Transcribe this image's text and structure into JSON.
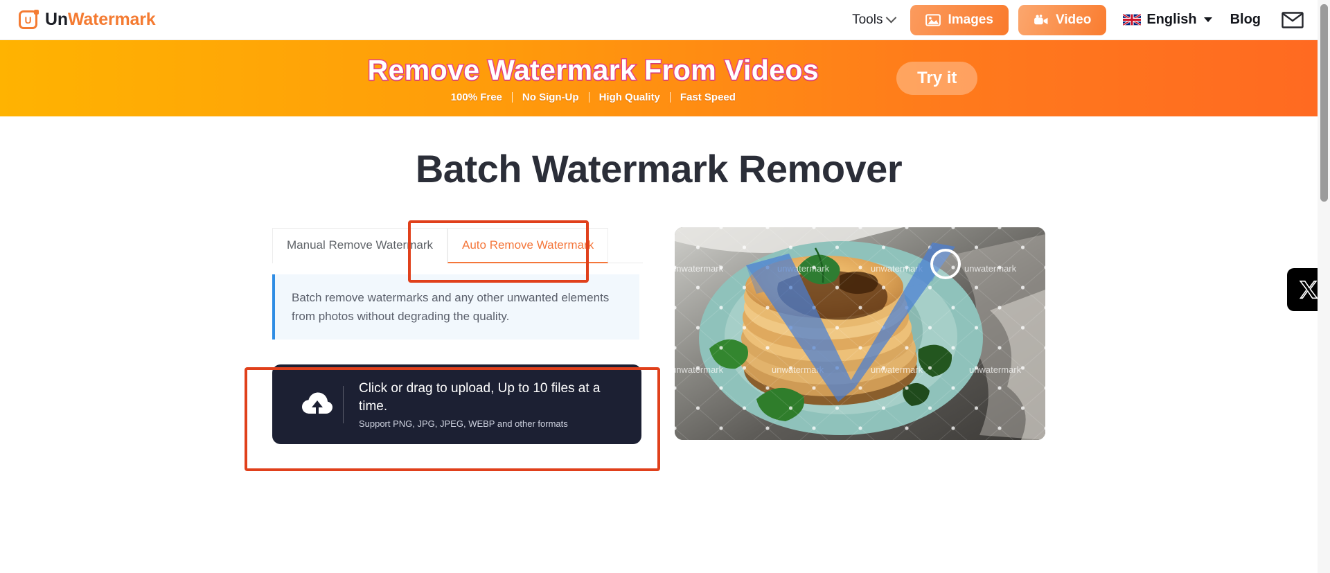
{
  "header": {
    "brand": {
      "logo_letter": "U",
      "name_part1": "Un",
      "name_part2": "Watermark"
    },
    "nav": {
      "tools_label": "Tools",
      "tools_icon": "chevron-down-icon",
      "images_label": "Images",
      "images_icon": "image-icon",
      "video_label": "Video",
      "video_icon": "video-camera-icon",
      "language_label": "English",
      "language_icon": "uk-flag-icon",
      "language_caret": "caret-down-icon",
      "blog_label": "Blog",
      "mail_icon": "envelope-icon"
    }
  },
  "banner": {
    "title": "Remove Watermark From Videos",
    "features": [
      "100% Free",
      "No Sign-Up",
      "High Quality",
      "Fast Speed"
    ],
    "cta_label": "Try it",
    "gradient_start": "#FFB301",
    "gradient_end": "#FF6A21",
    "title_stroke_color": "#E8447F"
  },
  "main": {
    "page_title": "Batch Watermark Remover",
    "tabs": [
      {
        "label": "Manual Remove Watermark",
        "active": false
      },
      {
        "label": "Auto Remove Watermark",
        "active": true
      }
    ],
    "active_tab_color": "#F4763A",
    "info": {
      "text": "Batch remove watermarks and any other unwanted elements from photos without degrading the quality.",
      "accent_color": "#2f8de4",
      "background_color": "#f2f8fd"
    },
    "upload": {
      "icon": "cloud-upload-icon",
      "primary_text": "Click or drag to upload, Up to 10 files at a time.",
      "secondary_text": "Support PNG, JPG, JPEG, WEBP and other formats",
      "background_color": "#1c2033"
    },
    "preview": {
      "alt": "pancake-stack-with-watermark-overlay",
      "watermark_text": "unwatermark",
      "brush_color": "#4a7fd4",
      "plate_color": "#8fc2bb"
    },
    "annotations": [
      {
        "name": "auto-tab-highlight",
        "color": "#E0401B"
      },
      {
        "name": "upload-area-highlight",
        "color": "#E0401B"
      }
    ]
  },
  "social": {
    "x_label": "X",
    "x_icon": "x-twitter-icon"
  },
  "scrollbar": {
    "thumb_color": "#9b9b9b"
  }
}
